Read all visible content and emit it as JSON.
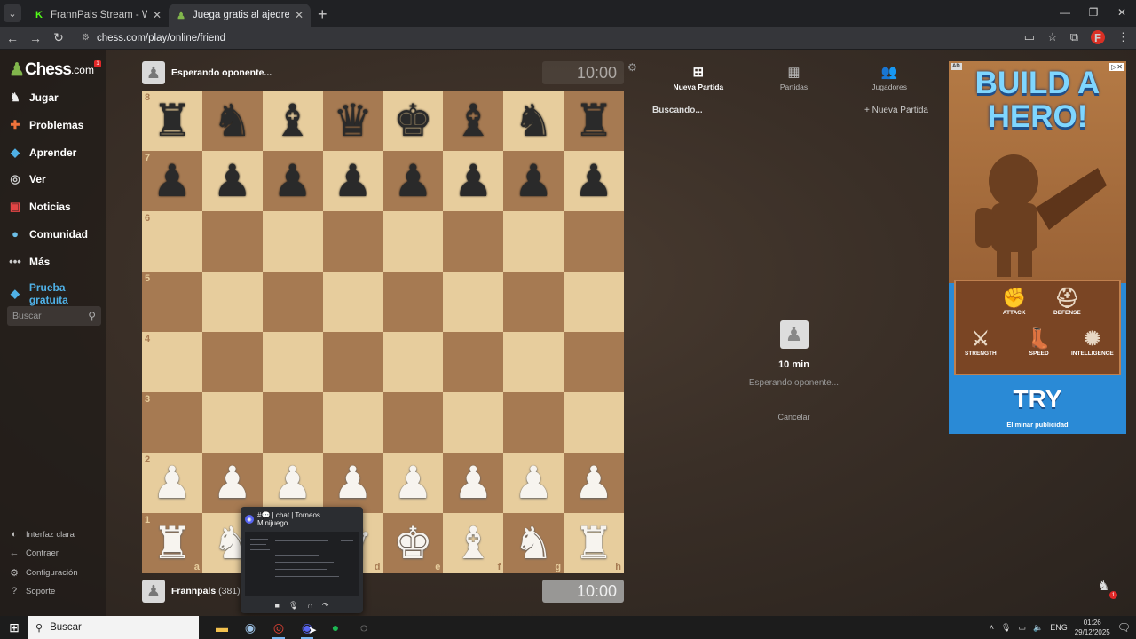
{
  "browser": {
    "tabs": [
      {
        "title": "FrannPals Stream - Watch Live o",
        "active": false,
        "icon": "kick-icon"
      },
      {
        "title": "Juega gratis al ajedrez online co",
        "active": true,
        "icon": "chesscom-icon"
      }
    ],
    "url": "chess.com/play/online/friend",
    "profile_initial": "F"
  },
  "sidebar": {
    "logo": "Chess",
    "logo_suffix": ".com",
    "notif_count": "1",
    "items": [
      {
        "label": "Jugar",
        "icon": "play-icon"
      },
      {
        "label": "Problemas",
        "icon": "puzzle-icon"
      },
      {
        "label": "Aprender",
        "icon": "learn-icon"
      },
      {
        "label": "Ver",
        "icon": "watch-icon"
      },
      {
        "label": "Noticias",
        "icon": "news-icon"
      },
      {
        "label": "Comunidad",
        "icon": "community-icon"
      },
      {
        "label": "Más",
        "icon": "more-icon"
      },
      {
        "label": "Prueba gratuita",
        "icon": "diamond-icon"
      }
    ],
    "search_placeholder": "Buscar",
    "footer": [
      {
        "label": "Interfaz clara",
        "icon": "theme-icon"
      },
      {
        "label": "Contraer",
        "icon": "collapse-icon"
      },
      {
        "label": "Configuración",
        "icon": "settings-icon"
      },
      {
        "label": "Soporte",
        "icon": "help-icon"
      }
    ]
  },
  "game": {
    "top_player": {
      "name": "Esperando oponente..."
    },
    "bottom_player": {
      "name": "Frannpals",
      "rating": "(381)"
    },
    "top_clock": "10:00",
    "bottom_clock": "10:00",
    "ranks": [
      "8",
      "7",
      "6",
      "5",
      "4",
      "3",
      "2",
      "1"
    ],
    "files": [
      "a",
      "b",
      "c",
      "d",
      "e",
      "f",
      "g",
      "h"
    ],
    "position": [
      [
        "r",
        "n",
        "b",
        "q",
        "k",
        "b",
        "n",
        "r"
      ],
      [
        "p",
        "p",
        "p",
        "p",
        "p",
        "p",
        "p",
        "p"
      ],
      [
        "",
        "",
        "",
        "",
        "",
        "",
        "",
        ""
      ],
      [
        "",
        "",
        "",
        "",
        "",
        "",
        "",
        ""
      ],
      [
        "",
        "",
        "",
        "",
        "",
        "",
        "",
        ""
      ],
      [
        "",
        "",
        "",
        "",
        "",
        "",
        "",
        ""
      ],
      [
        "P",
        "P",
        "P",
        "P",
        "P",
        "P",
        "P",
        "P"
      ],
      [
        "R",
        "N",
        "B",
        "Q",
        "K",
        "B",
        "N",
        "R"
      ]
    ]
  },
  "right_panel": {
    "tabs": [
      {
        "label": "Nueva Partida",
        "icon": "plus-icon",
        "active": true
      },
      {
        "label": "Partidas",
        "icon": "board-icon",
        "active": false
      },
      {
        "label": "Jugadores",
        "icon": "players-icon",
        "active": false
      }
    ],
    "searching": "Buscando...",
    "new_game_link": "Nueva Partida",
    "time_control": "10 min",
    "waiting": "Esperando oponente...",
    "cancel": "Cancelar"
  },
  "ad": {
    "badge": "AD",
    "title": "BUILD A HERO!",
    "stats": [
      "ATTACK",
      "DEFENSE",
      "STRENGTH",
      "SPEED",
      "INTELLIGENCE"
    ],
    "cta": "TRY",
    "remove": "Eliminar publicidad"
  },
  "discord_preview": {
    "title": "#💬 | chat | Torneos Minijuego..."
  },
  "taskbar": {
    "search": "Buscar",
    "apps": [
      "file-explorer-icon",
      "steam-icon",
      "chrome-icon",
      "discord-icon",
      "spotify-icon",
      "obs-icon"
    ],
    "lang": "ENG",
    "time": "01:26",
    "date": "29/12/2025",
    "notif_count": "1"
  },
  "colors": {
    "light_square": "#e7cd9d",
    "dark_square": "#a67a52",
    "brand_green": "#81b64c",
    "trial_blue": "#4fb0e6"
  }
}
